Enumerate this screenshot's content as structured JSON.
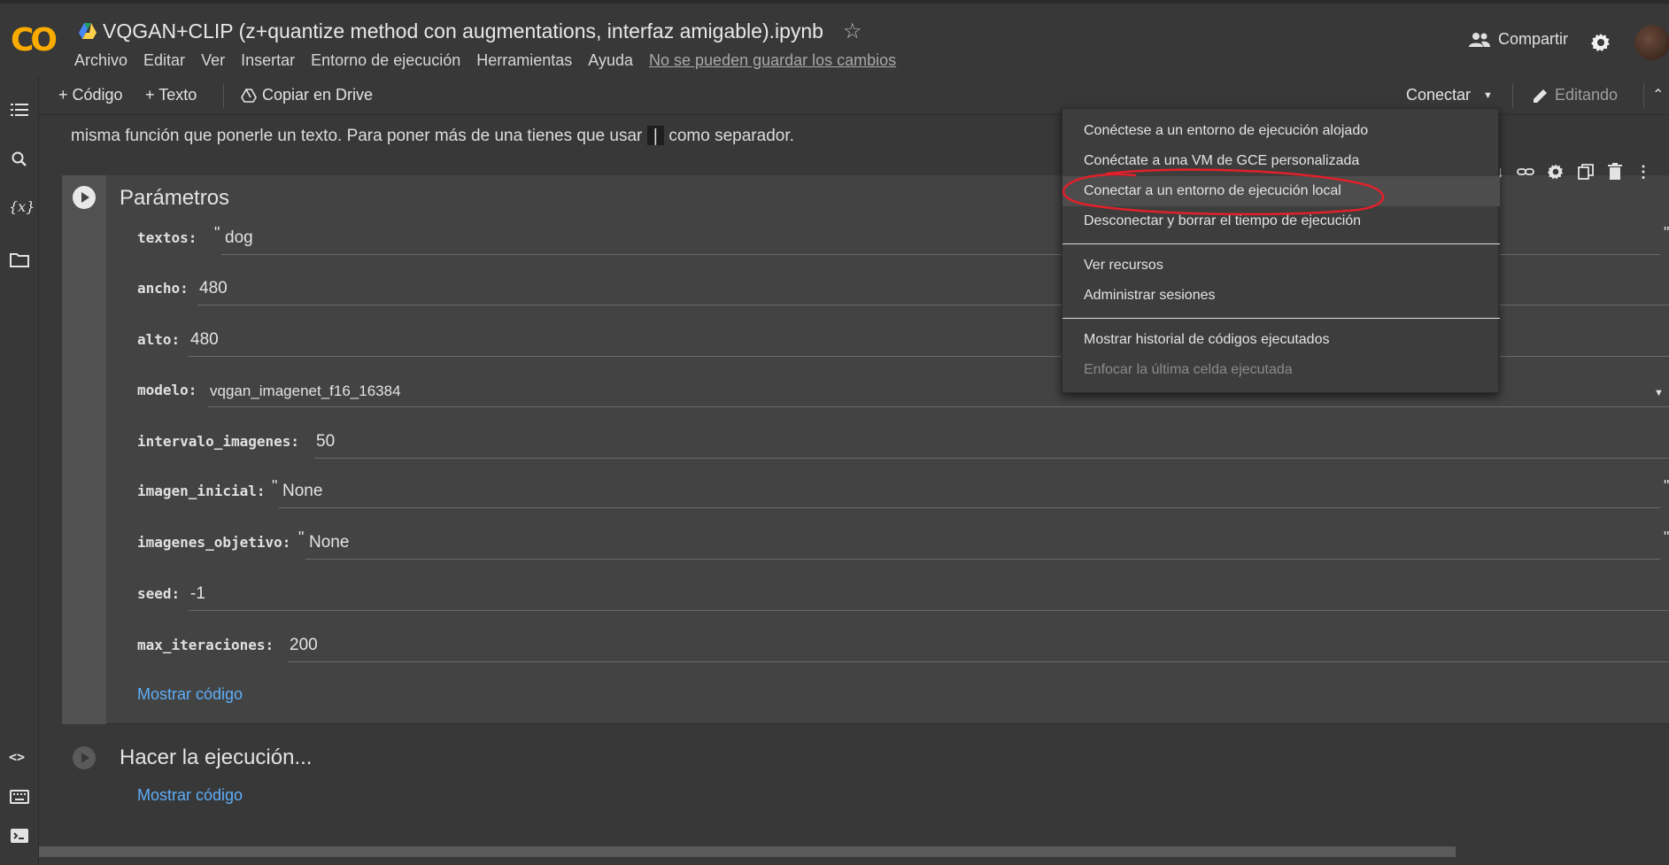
{
  "header": {
    "logo": "CO",
    "notebook_title": "VQGAN+CLIP (z+quantize method con augmentations, interfaz amigable).ipynb",
    "menu": [
      "Archivo",
      "Editar",
      "Ver",
      "Insertar",
      "Entorno de ejecución",
      "Herramientas",
      "Ayuda"
    ],
    "save_warning": "No se pueden guardar los cambios",
    "share_label": "Compartir"
  },
  "toolbar": {
    "add_code": "+ Código",
    "add_text": "+ Texto",
    "copy_drive": "Copiar en Drive",
    "connect": "Conectar",
    "editing": "Editando"
  },
  "content": {
    "text_before": "misma función que ponerle un texto. Para poner más de una tienes que usar",
    "pipe": "|",
    "text_after": "como separador."
  },
  "cell1": {
    "title": "Parámetros",
    "fields": [
      {
        "label": "textos:",
        "value": "dog",
        "quoted": true
      },
      {
        "label": "ancho:",
        "value": "480"
      },
      {
        "label": "alto:",
        "value": "480"
      },
      {
        "label": "modelo:",
        "value": "vqgan_imagenet_f16_16384",
        "dropdown": true
      },
      {
        "label": "intervalo_imagenes:",
        "value": "50"
      },
      {
        "label": "imagen_inicial:",
        "value": "None",
        "quoted": true
      },
      {
        "label": "imagenes_objetivo:",
        "value": "None",
        "quoted": true
      },
      {
        "label": "seed:",
        "value": "-1"
      },
      {
        "label": "max_iteraciones:",
        "value": "200"
      }
    ],
    "show_code": "Mostrar código"
  },
  "cell2": {
    "title": "Hacer la ejecución...",
    "show_code": "Mostrar código"
  },
  "connect_menu": {
    "items": [
      "Conéctese a un entorno de ejecución alojado",
      "Conéctate a una VM de GCE personalizada",
      "Conectar a un entorno de ejecución local",
      "Desconectar y borrar el tiempo de ejecución",
      "Ver recursos",
      "Administrar sesiones",
      "Mostrar historial de códigos ejecutados",
      "Enfocar la última celda ejecutada"
    ],
    "highlighted_index": 2,
    "disabled_index": 7
  },
  "colors": {
    "background": "#383838",
    "logo": "#f9ab00",
    "link": "#5eaef8",
    "annotation": "#e0202a"
  }
}
